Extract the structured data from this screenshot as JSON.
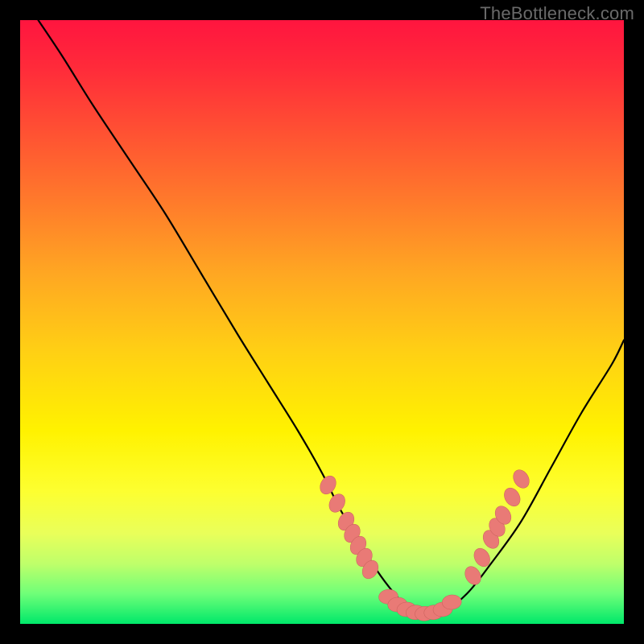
{
  "watermark": {
    "text": "TheBottleneck.com"
  },
  "colors": {
    "frame": "#000000",
    "curve": "#000000",
    "dot_fill": "#e97a76",
    "dot_stroke": "#c9605c"
  },
  "chart_data": {
    "type": "line",
    "title": "",
    "xlabel": "",
    "ylabel": "",
    "xlim": [
      0,
      100
    ],
    "ylim": [
      0,
      100
    ],
    "grid": false,
    "legend": false,
    "series": [
      {
        "name": "bottleneck-curve",
        "x": [
          3,
          7,
          12,
          18,
          24,
          30,
          36,
          41,
          46,
          50,
          53,
          56,
          59,
          62,
          64,
          66,
          70,
          74,
          78,
          83,
          88,
          93,
          98,
          100
        ],
        "y": [
          100,
          94,
          86,
          77,
          68,
          58,
          48,
          40,
          32,
          25,
          19,
          14,
          9,
          5,
          3,
          2,
          2,
          5,
          10,
          17,
          26,
          35,
          43,
          47
        ]
      }
    ],
    "markers": [
      {
        "name": "left-cluster",
        "points": [
          {
            "x": 51,
            "y": 23
          },
          {
            "x": 52.5,
            "y": 20
          },
          {
            "x": 54,
            "y": 17
          },
          {
            "x": 55,
            "y": 15
          },
          {
            "x": 56,
            "y": 13
          },
          {
            "x": 57,
            "y": 11
          },
          {
            "x": 58,
            "y": 9
          }
        ]
      },
      {
        "name": "bottom-cluster",
        "points": [
          {
            "x": 61,
            "y": 4.5
          },
          {
            "x": 62.5,
            "y": 3.2
          },
          {
            "x": 64,
            "y": 2.4
          },
          {
            "x": 65.5,
            "y": 1.9
          },
          {
            "x": 67,
            "y": 1.7
          },
          {
            "x": 68.5,
            "y": 1.9
          },
          {
            "x": 70,
            "y": 2.4
          },
          {
            "x": 71.5,
            "y": 3.6
          }
        ]
      },
      {
        "name": "right-cluster",
        "points": [
          {
            "x": 75,
            "y": 8
          },
          {
            "x": 76.5,
            "y": 11
          },
          {
            "x": 78,
            "y": 14
          },
          {
            "x": 79,
            "y": 16
          },
          {
            "x": 80,
            "y": 18
          },
          {
            "x": 81.5,
            "y": 21
          },
          {
            "x": 83,
            "y": 24
          }
        ]
      }
    ]
  }
}
